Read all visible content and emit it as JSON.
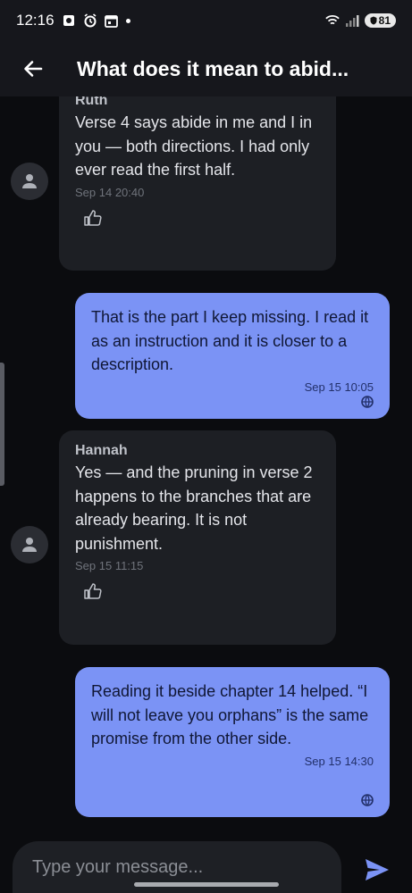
{
  "status_bar": {
    "time": "12:16",
    "battery": "81"
  },
  "header": {
    "title": "What does it mean to abid..."
  },
  "messages": [
    {
      "sender": "Ruth",
      "text": "Verse 4 says abide in me and I in you — both directions. I had only ever read the first half.",
      "time": "Sep 14 20:40"
    },
    {
      "text": "That is the part I keep missing. I read it as an instruction and it is closer to a description.",
      "time": "Sep 15 10:05"
    },
    {
      "sender": "Hannah",
      "text": "Yes — and the pruning in verse 2 happens to the branches that are already bearing. It is not punishment.",
      "time": "Sep 15 11:15"
    },
    {
      "text": "Reading it beside chapter 14 helped. “I will not leave you orphans” is the same promise from the other side.",
      "time": "Sep 15 14:30"
    }
  ],
  "composer": {
    "placeholder": "Type your message..."
  },
  "colors": {
    "outgoing_bubble": "#7b93f5",
    "incoming_bubble": "#1d1f24",
    "background": "#0b0c0f"
  }
}
